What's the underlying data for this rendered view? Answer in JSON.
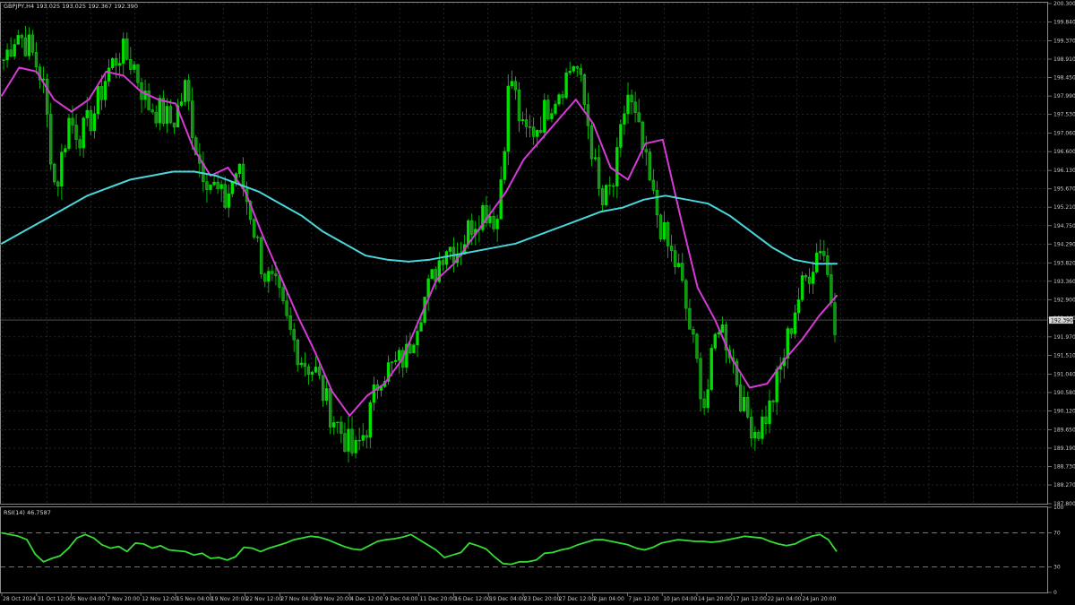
{
  "chart_data": [
    {
      "type": "candlestick",
      "title": "GBPJPY,H4  193.025 193.025 192.367 192.390",
      "ylim": [
        187.8,
        200.3
      ],
      "yticks": [
        "200.300",
        "199.840",
        "199.370",
        "198.910",
        "198.450",
        "197.990",
        "197.530",
        "197.060",
        "196.600",
        "196.130",
        "195.670",
        "195.210",
        "194.750",
        "194.290",
        "193.820",
        "193.360",
        "192.900",
        "192.440",
        "191.970",
        "191.510",
        "191.040",
        "190.580",
        "190.120",
        "189.650",
        "189.190",
        "188.730",
        "188.270",
        "187.800"
      ],
      "current_price": "192.390",
      "grid": true,
      "series": [
        {
          "name": "close",
          "color": "#00e000",
          "x": [
            0,
            0.01,
            0.02,
            0.03,
            0.04,
            0.05,
            0.06,
            0.07,
            0.08,
            0.09,
            0.1,
            0.11,
            0.12,
            0.13,
            0.14,
            0.15,
            0.16,
            0.17,
            0.18,
            0.19,
            0.2,
            0.21,
            0.22,
            0.23,
            0.24,
            0.25,
            0.26,
            0.27,
            0.28,
            0.29,
            0.3,
            0.31,
            0.32,
            0.33,
            0.34,
            0.35,
            0.36,
            0.37,
            0.38,
            0.39,
            0.4,
            0.41,
            0.42,
            0.43,
            0.44,
            0.45,
            0.46,
            0.47,
            0.48,
            0.49,
            0.5,
            0.51,
            0.52,
            0.53,
            0.54,
            0.55,
            0.56,
            0.57,
            0.58,
            0.59,
            0.6,
            0.61,
            0.62,
            0.63,
            0.64,
            0.65,
            0.66,
            0.67,
            0.68,
            0.69,
            0.7,
            0.71,
            0.72,
            0.73,
            0.74,
            0.75,
            0.76,
            0.77,
            0.78,
            0.79,
            0.8,
            0.81,
            0.82,
            0.83,
            0.84,
            0.85,
            0.86,
            0.87,
            0.88,
            0.89,
            0.9,
            0.91,
            0.92,
            0.93,
            0.94,
            0.95,
            0.96,
            0.97,
            0.98,
            0.99,
            1.0
          ],
          "values": [
            198.9,
            199.6,
            199.2,
            198.4,
            195.6,
            197.4,
            197.0,
            197.6,
            198.6,
            199.1,
            198.8,
            197.8,
            197.6,
            197.3,
            198.2,
            196.4,
            195.8,
            195.3,
            196.2,
            195.1,
            193.6,
            193.1,
            192.1,
            191.4,
            191.1,
            190.2,
            189.6,
            189.0,
            189.8,
            191.1,
            191.2,
            191.5,
            192.6,
            193.4,
            194.3,
            194.1,
            194.8,
            195.2,
            194.9,
            198.6,
            197.0,
            197.2,
            197.8,
            198.3,
            198.9,
            197.3,
            195.2,
            195.8,
            198.1,
            196.9,
            195.4,
            194.3,
            193.6,
            191.9,
            190.2,
            192.4,
            191.6,
            190.1,
            189.6,
            190.2,
            191.4,
            192.8,
            193.6,
            194.4,
            192.4,
            null,
            null,
            null,
            null,
            null,
            null,
            null,
            null,
            null,
            null,
            null,
            null,
            null,
            null,
            null,
            null,
            null,
            null,
            null,
            null,
            null,
            null,
            null,
            null,
            null,
            null,
            null,
            null,
            null,
            null,
            null,
            null,
            null,
            null,
            null,
            null
          ]
        },
        {
          "name": "ma-fast",
          "color": "#d63ad6",
          "values": [
            198.0,
            198.7,
            198.6,
            197.9,
            197.6,
            197.9,
            198.6,
            198.5,
            198.1,
            197.9,
            197.8,
            196.7,
            196.0,
            196.2,
            195.6,
            194.5,
            193.5,
            192.5,
            191.6,
            190.6,
            190.0,
            190.5,
            190.8,
            191.4,
            192.4,
            193.4,
            193.8,
            194.4,
            195.0,
            195.6,
            196.4,
            196.9,
            197.4,
            197.9,
            197.3,
            196.2,
            195.9,
            196.8,
            196.9,
            195.0,
            193.2,
            192.4,
            191.4,
            190.7,
            190.8,
            191.4,
            191.9,
            192.5,
            193.0
          ]
        },
        {
          "name": "ma-slow",
          "color": "#49d6dc",
          "values": [
            194.3,
            194.6,
            194.9,
            195.2,
            195.5,
            195.7,
            195.9,
            196.0,
            196.1,
            196.1,
            196.0,
            195.8,
            195.6,
            195.3,
            195.0,
            194.6,
            194.3,
            194.0,
            193.9,
            193.85,
            193.9,
            194.0,
            194.1,
            194.2,
            194.3,
            194.5,
            194.7,
            194.9,
            195.1,
            195.2,
            195.4,
            195.5,
            195.4,
            195.3,
            195.0,
            194.6,
            194.2,
            193.9,
            193.8,
            193.8
          ]
        }
      ]
    },
    {
      "type": "line",
      "title": "RSI(14) 46.7587",
      "ylim": [
        0,
        100
      ],
      "yticks": [
        "100",
        "70",
        "30",
        "0"
      ],
      "levels": [
        70,
        30
      ],
      "series": [
        {
          "name": "RSI",
          "color": "#33dd33",
          "values": [
            70,
            68,
            66,
            62,
            45,
            36,
            40,
            43,
            52,
            64,
            68,
            64,
            56,
            52,
            54,
            48,
            58,
            57,
            52,
            55,
            50,
            49,
            48,
            44,
            46,
            40,
            41,
            38,
            42,
            53,
            52,
            48,
            52,
            55,
            58,
            62,
            64,
            66,
            65,
            62,
            58,
            54,
            51,
            50,
            55,
            60,
            62,
            63,
            65,
            68,
            62,
            56,
            50,
            41,
            44,
            47,
            58,
            55,
            51,
            42,
            34,
            33,
            36,
            36,
            38,
            46,
            47,
            50,
            52,
            56,
            59,
            62,
            62,
            60,
            58,
            56,
            52,
            50,
            53,
            58,
            60,
            62,
            61,
            60,
            60,
            59,
            60,
            62,
            64,
            66,
            65,
            64,
            60,
            57,
            55,
            57,
            62,
            66,
            68,
            62,
            48
          ]
        }
      ]
    }
  ],
  "x_axis": {
    "labels": [
      "28 Oct 2024",
      "31 Oct 12:00",
      "5 Nov 04:00",
      "7 Nov 20:00",
      "12 Nov 12:00",
      "15 Nov 04:00",
      "19 Nov 20:00",
      "22 Nov 12:00",
      "27 Nov 04:00",
      "29 Nov 20:00",
      "4 Dec 12:00",
      "9 Dec 04:00",
      "11 Dec 20:00",
      "16 Dec 12:00",
      "19 Dec 04:00",
      "23 Dec 20:00",
      "27 Dec 12:00",
      "2 Jan 04:00",
      "7 Jan 12:00",
      "10 Jan 04:00",
      "14 Jan 20:00",
      "17 Jan 12:00",
      "22 Jan 04:00",
      "24 Jan 20:00"
    ]
  },
  "colors": {
    "background": "#000000",
    "grid": "#3a3a3a",
    "axis_text": "#c8c8c8",
    "candle": "#00e000",
    "candle_dark": "#1f8a1f"
  }
}
